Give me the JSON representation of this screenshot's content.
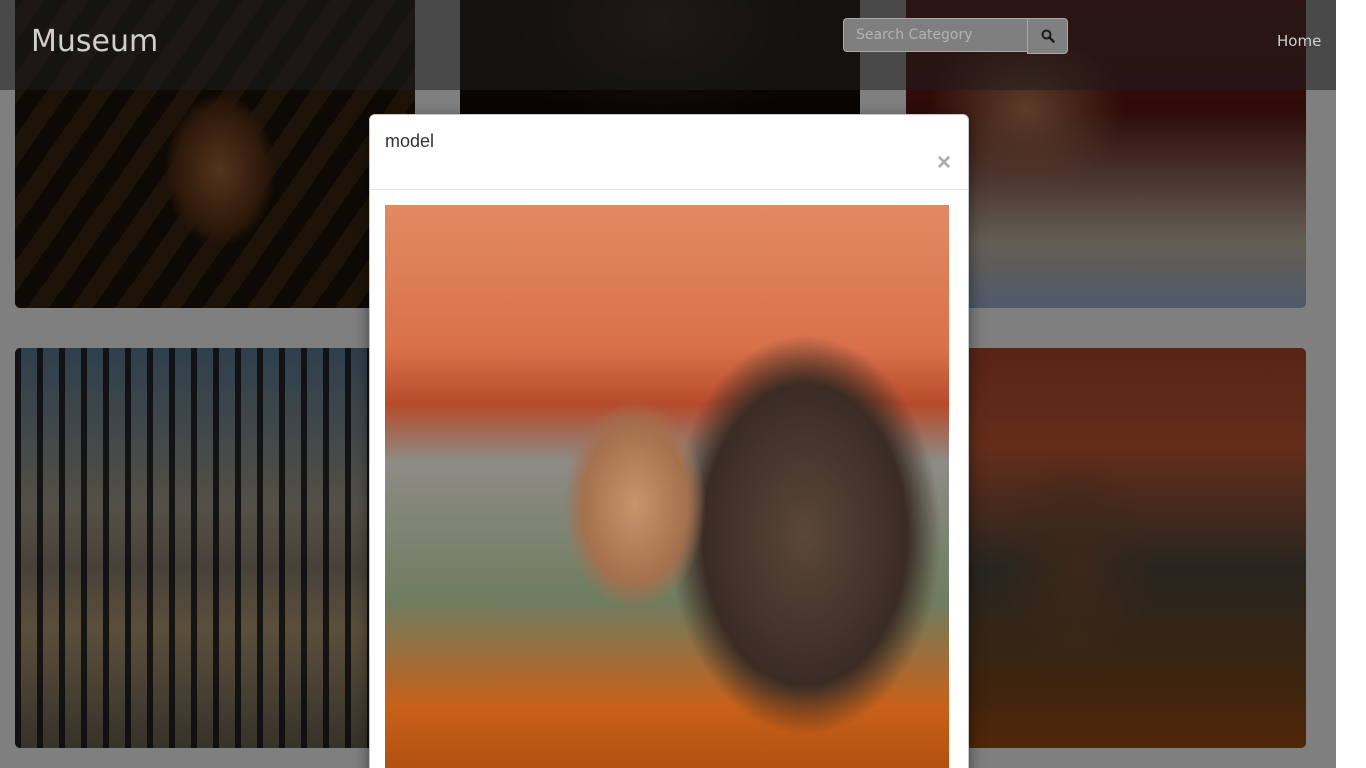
{
  "navbar": {
    "brand": "Museum",
    "search_placeholder": "Search Category",
    "nav_links": [
      {
        "label": "Home"
      }
    ]
  },
  "icons": {
    "search": "search-icon",
    "close": "close-icon"
  },
  "gallery": {
    "items": [
      {
        "name": "gallery-photo-1"
      },
      {
        "name": "gallery-photo-2"
      },
      {
        "name": "gallery-photo-3"
      },
      {
        "name": "gallery-photo-4"
      },
      {
        "name": "gallery-photo-5"
      }
    ]
  },
  "modal": {
    "title": "model",
    "close_glyph": "×"
  },
  "colors": {
    "navbar_overlay": "#1e1e1e",
    "backdrop": "#000000",
    "modal_bg": "#ffffff",
    "title_text": "#333333",
    "close_text": "#aaaaaa"
  }
}
